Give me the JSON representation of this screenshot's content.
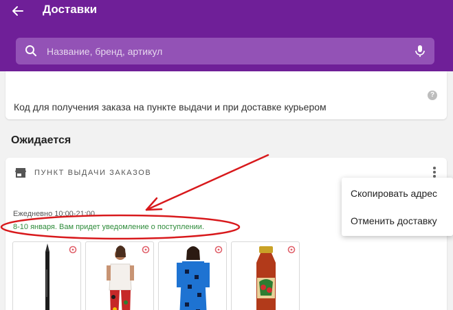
{
  "header": {
    "title": "Доставки",
    "back_icon": "arrow-left-icon"
  },
  "search": {
    "placeholder": "Название, бренд, артикул",
    "search_icon": "search-icon",
    "mic_icon": "mic-icon"
  },
  "code_card": {
    "text": "Код для получения заказа на пункте выдачи и при доставке курьером",
    "help_icon_glyph": "?"
  },
  "section": {
    "title": "Ожидается"
  },
  "pickup": {
    "label": "ПУНКТ ВЫДАЧИ ЗАКАЗОВ",
    "hours": "Ежедневно 10:00-21:00",
    "delivery_note": "8-10 января. Вам придет уведомление о поступлении."
  },
  "products": [
    {
      "name": "pencil",
      "tag_icon": "tag-icon"
    },
    {
      "name": "tshirt-leggings",
      "tag_icon": "tag-icon"
    },
    {
      "name": "blue-dress",
      "tag_icon": "tag-icon"
    },
    {
      "name": "sauce-jar",
      "tag_icon": "tag-icon"
    }
  ],
  "menu": {
    "items": [
      "Скопировать адрес",
      "Отменить доставку"
    ]
  },
  "colors": {
    "appbar": "#6f1f98",
    "search_bg": "#9352b6",
    "note_green": "#2e8b3a",
    "annotation_red": "#d8191c"
  }
}
